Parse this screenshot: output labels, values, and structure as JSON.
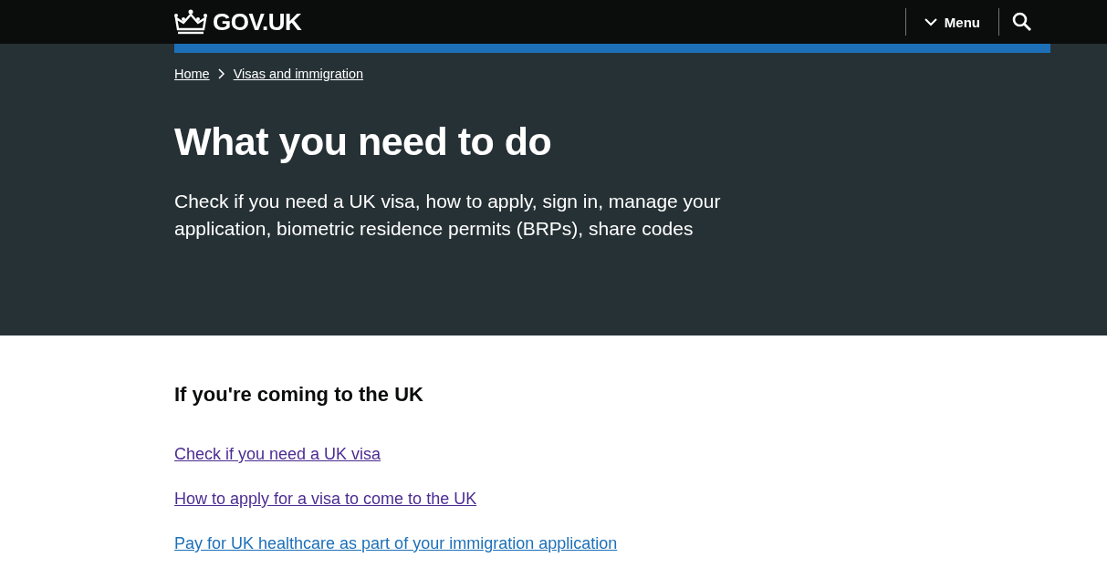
{
  "header": {
    "logo": "GOV.UK",
    "menu": "Menu"
  },
  "breadcrumbs": [
    "Home",
    "Visas and immigration"
  ],
  "hero": {
    "title": "What you need to do",
    "description": "Check if you need a UK visa, how to apply, sign in, manage your application, biometric residence permits (BRPs), share codes"
  },
  "section": {
    "heading": "If you're coming to the UK",
    "links": [
      {
        "text": "Check if you need a UK visa",
        "visited": true
      },
      {
        "text": "How to apply for a visa to come to the UK",
        "visited": true
      },
      {
        "text": "Pay for UK healthcare as part of your immigration application",
        "visited": false
      }
    ]
  }
}
